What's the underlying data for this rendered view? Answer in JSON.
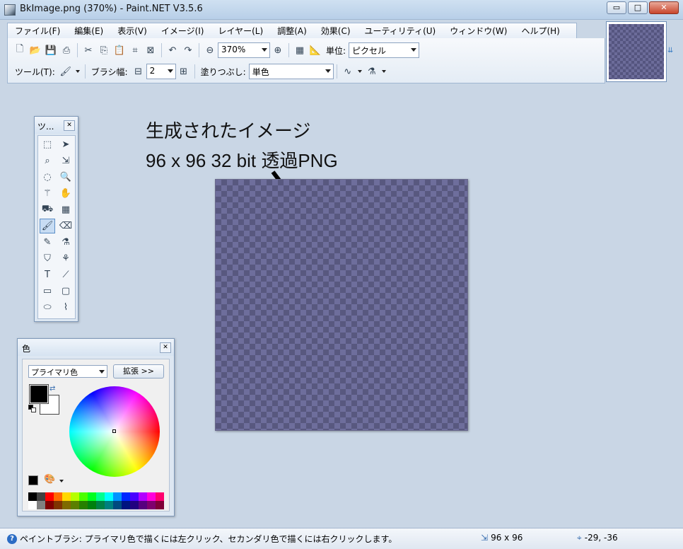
{
  "window": {
    "title": "BkImage.png (370%) - Paint.NET V3.5.6",
    "buttons": [
      "▭",
      "□",
      "✕"
    ]
  },
  "menu": [
    "ファイル(F)",
    "編集(E)",
    "表示(V)",
    "イメージ(I)",
    "レイヤー(L)",
    "調整(A)",
    "効果(C)",
    "ユーティリティ(U)",
    "ウィンドウ(W)",
    "ヘルプ(H)"
  ],
  "toolbar": {
    "zoom_value": "370%",
    "unit_label": "単位:",
    "unit_value": "ピクセル",
    "tool_label": "ツール(T):",
    "brush_width_label": "ブラシ幅:",
    "brush_width_value": "2",
    "fill_label": "塗りつぶし:",
    "fill_value": "単色"
  },
  "annotation": {
    "line1": "生成されたイメージ",
    "line2": "96 x 96 32 bit 透過PNG"
  },
  "tools_window": {
    "title": "ツ...",
    "tools": [
      {
        "name": "rectangle-select-tool-icon",
        "glyph": "⬚"
      },
      {
        "name": "move-selection-tool-icon",
        "glyph": "➤"
      },
      {
        "name": "lasso-select-tool-icon",
        "glyph": "⌕"
      },
      {
        "name": "move-selected-tool-icon",
        "glyph": "⇲"
      },
      {
        "name": "ellipse-select-tool-icon",
        "glyph": "◌"
      },
      {
        "name": "zoom-tool-icon",
        "glyph": "🔍"
      },
      {
        "name": "magic-wand-tool-icon",
        "glyph": "⚚"
      },
      {
        "name": "pan-tool-icon",
        "glyph": "✋"
      },
      {
        "name": "paint-bucket-tool-icon",
        "glyph": "⛟"
      },
      {
        "name": "gradient-tool-icon",
        "glyph": "▦"
      },
      {
        "name": "paintbrush-tool-icon",
        "glyph": "🖌"
      },
      {
        "name": "eraser-tool-icon",
        "glyph": "⌫"
      },
      {
        "name": "pencil-tool-icon",
        "glyph": "✎"
      },
      {
        "name": "color-picker-tool-icon",
        "glyph": "⚗"
      },
      {
        "name": "clone-stamp-tool-icon",
        "glyph": "⛉"
      },
      {
        "name": "recolor-tool-icon",
        "glyph": "⚘"
      },
      {
        "name": "text-tool-icon",
        "glyph": "T"
      },
      {
        "name": "line-curve-tool-icon",
        "glyph": "⟋"
      },
      {
        "name": "rectangle-tool-icon",
        "glyph": "▭"
      },
      {
        "name": "rounded-rectangle-tool-icon",
        "glyph": "▢"
      },
      {
        "name": "ellipse-tool-icon",
        "glyph": "⬭"
      },
      {
        "name": "freeform-shape-tool-icon",
        "glyph": "⌇"
      }
    ]
  },
  "colors_window": {
    "title": "色",
    "mode_value": "プライマリ色",
    "expand_label": "拡張 >>",
    "primary_color": "#000000",
    "secondary_color": "#ffffff",
    "palette": [
      "#000000",
      "#404040",
      "#ff0000",
      "#ff6a00",
      "#ffd800",
      "#b6ff00",
      "#4cff00",
      "#00ff21",
      "#00ff90",
      "#00ffff",
      "#0094ff",
      "#0026ff",
      "#4800ff",
      "#b200ff",
      "#ff00dc",
      "#ff006e",
      "#ffffff",
      "#808080",
      "#7f0000",
      "#7f3300",
      "#7f6a00",
      "#5b7f00",
      "#267f00",
      "#007f0e",
      "#007f46",
      "#007f7f",
      "#004a7f",
      "#00137f",
      "#21007f",
      "#57007f",
      "#7f006e",
      "#7f0037"
    ]
  },
  "status": {
    "help_text": "ペイントブラシ: プライマリ色で描くには左クリック、セカンダリ色で描くには右クリックします。",
    "image_size": "96 x 96",
    "cursor_position": "-29, -36"
  }
}
